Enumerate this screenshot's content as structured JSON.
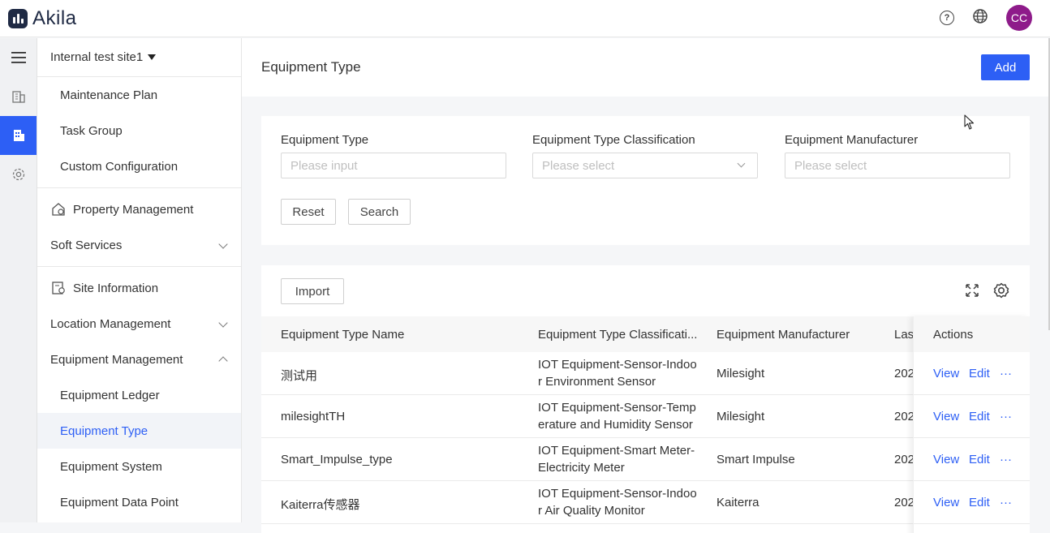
{
  "app": {
    "name": "Akila"
  },
  "topbar": {
    "help_icon": "question-circle-icon",
    "language_icon": "globe-icon",
    "avatar_initials": "CC",
    "avatar_color": "#8e1b8a"
  },
  "accent_color": "#2d5ff5",
  "sidebar": {
    "site": "Internal test site1",
    "items": [
      {
        "label": "Maintenance Plan"
      },
      {
        "label": "Task Group"
      },
      {
        "label": "Custom Configuration"
      },
      {
        "label": "Property Management"
      },
      {
        "label": "Soft Services"
      },
      {
        "label": "Site Information"
      },
      {
        "label": "Location Management"
      },
      {
        "label": "Equipment Management"
      },
      {
        "label": "Equipment Ledger"
      },
      {
        "label": "Equipment Type"
      },
      {
        "label": "Equipment System"
      },
      {
        "label": "Equipment Data Point"
      }
    ]
  },
  "page": {
    "title": "Equipment Type",
    "add_label": "Add"
  },
  "filters": {
    "type_label": "Equipment Type",
    "type_placeholder": "Please input",
    "classification_label": "Equipment Type Classification",
    "classification_placeholder": "Please select",
    "manufacturer_label": "Equipment Manufacturer",
    "manufacturer_placeholder": "Please select",
    "reset_label": "Reset",
    "search_label": "Search"
  },
  "table": {
    "import_label": "Import",
    "columns": [
      "Equipment Type Name",
      "Equipment Type Classificati...",
      "Equipment Manufacturer",
      "Las",
      "Actions"
    ],
    "rows": [
      {
        "name": "测试用",
        "classification": "IOT Equipment-Sensor-Indoor Environment Sensor",
        "manufacturer": "Milesight",
        "last": "202"
      },
      {
        "name": "milesightTH",
        "classification": "IOT Equipment-Sensor-Temperature and Humidity Sensor",
        "manufacturer": "Milesight",
        "last": "202"
      },
      {
        "name": "Smart_Impulse_type",
        "classification": "IOT Equipment-Smart Meter-Electricity Meter",
        "manufacturer": "Smart Impulse",
        "last": "202"
      },
      {
        "name": "Kaiterra传感器",
        "classification": "IOT Equipment-Sensor-Indoor Air Quality Monitor",
        "manufacturer": "Kaiterra",
        "last": "202"
      }
    ],
    "action_view": "View",
    "action_edit": "Edit",
    "action_more": "···"
  }
}
